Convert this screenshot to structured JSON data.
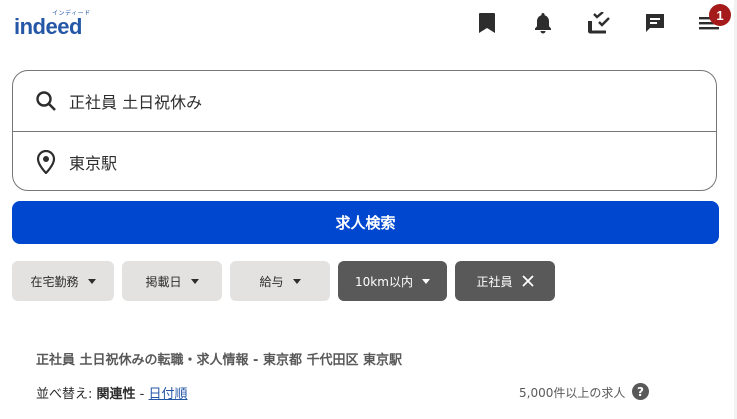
{
  "header": {
    "logo_kana": "インディード",
    "logo_word": "indeed",
    "notification_count": "1"
  },
  "search": {
    "what_value": "正社員 土日祝休み",
    "where_value": "東京駅",
    "button_label": "求人検索"
  },
  "filters": [
    {
      "label": "在宅勤務",
      "active": false
    },
    {
      "label": "掲載日",
      "active": false
    },
    {
      "label": "給与",
      "active": false
    },
    {
      "label": "10km以内",
      "active": true
    },
    {
      "label": "正社員",
      "active": true,
      "removable": true
    }
  ],
  "results": {
    "title": "正社員 土日祝休みの転職・求人情報 - 東京都 千代田区 東京駅",
    "sort_prefix": "並べ替え: ",
    "sort_relevance": "関連性",
    "sort_separator": " - ",
    "sort_date": "日付順",
    "count": "5,000件以上の求人",
    "help_symbol": "?"
  },
  "colors": {
    "brand": "#2557a7",
    "search_button": "#0047d0",
    "badge": "#a51b1b"
  },
  "icons": [
    "bookmark-icon",
    "bell-icon",
    "my-jobs-icon",
    "messages-icon",
    "menu-icon",
    "search-icon",
    "location-pin-icon",
    "close-icon"
  ]
}
